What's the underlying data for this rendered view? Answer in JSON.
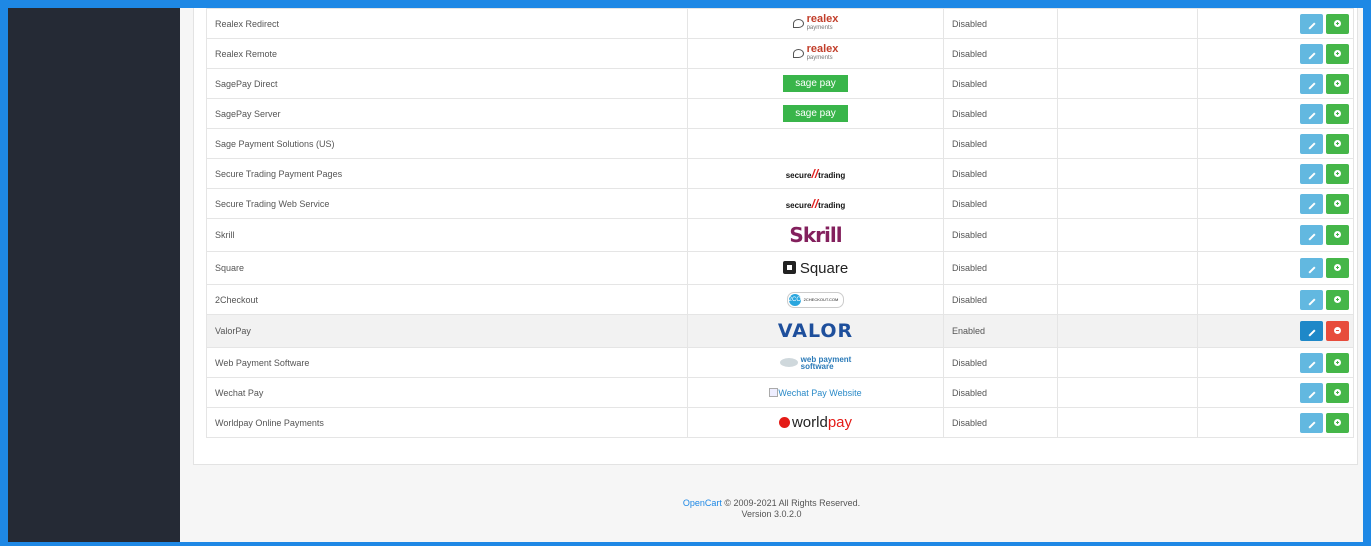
{
  "rows": [
    {
      "name": "Realex Redirect",
      "logo": "realex",
      "logo_text": "realex",
      "logo_sub": "payments",
      "status": "Disabled"
    },
    {
      "name": "Realex Remote",
      "logo": "realex",
      "logo_text": "realex",
      "logo_sub": "payments",
      "status": "Disabled"
    },
    {
      "name": "SagePay Direct",
      "logo": "sage",
      "logo_text": "sage pay",
      "status": "Disabled"
    },
    {
      "name": "SagePay Server",
      "logo": "sage",
      "logo_text": "sage pay",
      "status": "Disabled"
    },
    {
      "name": "Sage Payment Solutions (US)",
      "logo": "none",
      "status": "Disabled"
    },
    {
      "name": "Secure Trading Payment Pages",
      "logo": "secure",
      "logo_text": "secure",
      "logo_text2": "trading",
      "status": "Disabled"
    },
    {
      "name": "Secure Trading Web Service",
      "logo": "secure",
      "logo_text": "secure",
      "logo_text2": "trading",
      "status": "Disabled"
    },
    {
      "name": "Skrill",
      "logo": "skrill",
      "logo_text": "Skrill",
      "status": "Disabled"
    },
    {
      "name": "Square",
      "logo": "square",
      "logo_text": "Square",
      "status": "Disabled"
    },
    {
      "name": "2Checkout",
      "logo": "2co",
      "logo_text": "2CHECKOUT.COM",
      "logo_badge": "2CO",
      "status": "Disabled"
    },
    {
      "name": "ValorPay",
      "logo": "valor",
      "logo_text": "VALOR",
      "status": "Enabled",
      "enabled": true
    },
    {
      "name": "Web Payment Software",
      "logo": "wps",
      "logo_text": "web payment",
      "logo_sub": "software",
      "status": "Disabled"
    },
    {
      "name": "Wechat Pay",
      "logo": "wechat",
      "logo_text": "Wechat Pay Website",
      "status": "Disabled"
    },
    {
      "name": "Worldpay Online Payments",
      "logo": "worldpay",
      "logo_text": "world",
      "logo_text2": "pay",
      "status": "Disabled"
    }
  ],
  "footer": {
    "brand": "OpenCart",
    "copyright": " © 2009-2021 All Rights Reserved.",
    "version": "Version 3.0.2.0"
  },
  "colors": {
    "frame_border": "#1e88e5",
    "sidebar": "#252a35",
    "edit": "#62b8e0",
    "edit_active": "#1e88c8",
    "install": "#45b649",
    "uninstall": "#e74c3c"
  },
  "icons": {
    "edit": "pencil-icon",
    "install": "plus-circle-icon",
    "uninstall": "minus-circle-icon"
  }
}
